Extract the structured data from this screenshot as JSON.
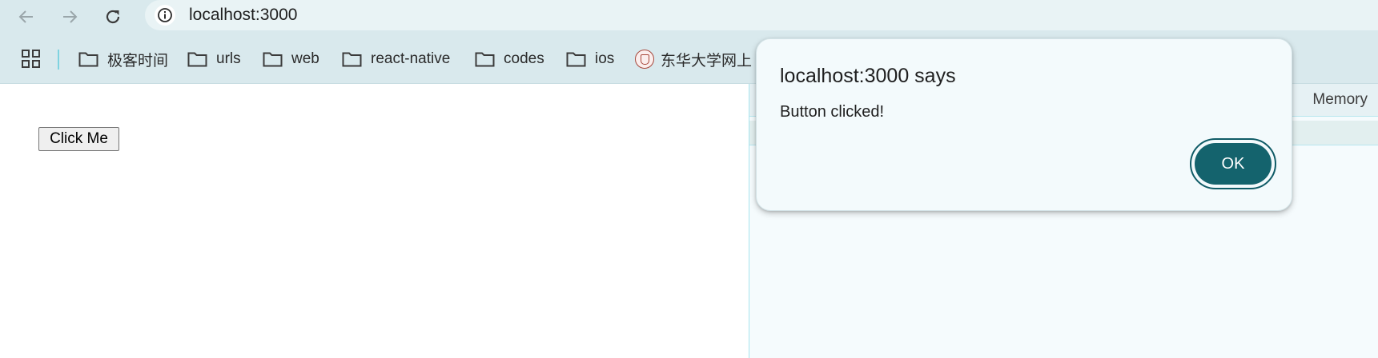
{
  "browser": {
    "url": "localhost:3000",
    "bookmarks": [
      {
        "label": "极客时间",
        "icon": "folder-icon"
      },
      {
        "label": "urls",
        "icon": "folder-icon"
      },
      {
        "label": "web",
        "icon": "folder-icon"
      },
      {
        "label": "react-native",
        "icon": "folder-icon"
      },
      {
        "label": "codes",
        "icon": "folder-icon"
      },
      {
        "label": "ios",
        "icon": "folder-icon"
      },
      {
        "label": "东华大学网上",
        "icon": "university-seal-icon"
      }
    ]
  },
  "page": {
    "button_label": "Click Me"
  },
  "devtools": {
    "memory_tab": "Memory"
  },
  "dialog": {
    "title": "localhost:3000 says",
    "message": "Button clicked!",
    "ok_label": "OK"
  },
  "colors": {
    "toolbar_bg": "#d9e9ed",
    "ok_button_bg": "#14636d",
    "dialog_bg": "#f3fafc"
  }
}
